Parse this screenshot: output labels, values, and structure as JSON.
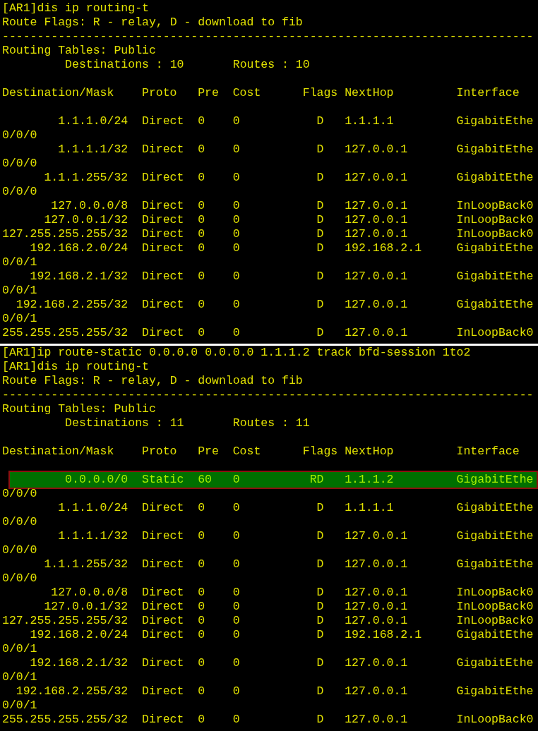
{
  "panels": [
    {
      "commands": [
        "[AR1]dis ip routing-t"
      ],
      "flags_legend": "Route Flags: R - relay, D - download to fib",
      "rule": "----------------------------------------------------------------------------",
      "table_title": "Routing Tables: Public",
      "summary": [
        "Destinations : 10",
        "Routes : 10"
      ],
      "columns": [
        "Destination/Mask",
        "Proto",
        "Pre",
        "Cost",
        "Flags",
        "NextHop",
        "Interface"
      ],
      "routes": [
        {
          "destination": "1.1.1.0/24",
          "proto": "Direct",
          "pre": "0",
          "cost": "0",
          "flags": "D",
          "nexthop": "1.1.1.1",
          "interface": "GigabitEthe",
          "interface_wrap": "0/0/0",
          "selected": false
        },
        {
          "destination": "1.1.1.1/32",
          "proto": "Direct",
          "pre": "0",
          "cost": "0",
          "flags": "D",
          "nexthop": "127.0.0.1",
          "interface": "GigabitEthe",
          "interface_wrap": "0/0/0",
          "selected": false
        },
        {
          "destination": "1.1.1.255/32",
          "proto": "Direct",
          "pre": "0",
          "cost": "0",
          "flags": "D",
          "nexthop": "127.0.0.1",
          "interface": "GigabitEthe",
          "interface_wrap": "0/0/0",
          "selected": false
        },
        {
          "destination": "127.0.0.0/8",
          "proto": "Direct",
          "pre": "0",
          "cost": "0",
          "flags": "D",
          "nexthop": "127.0.0.1",
          "interface": "InLoopBack0",
          "selected": false
        },
        {
          "destination": "127.0.0.1/32",
          "proto": "Direct",
          "pre": "0",
          "cost": "0",
          "flags": "D",
          "nexthop": "127.0.0.1",
          "interface": "InLoopBack0",
          "selected": false
        },
        {
          "destination": "127.255.255.255/32",
          "proto": "Direct",
          "pre": "0",
          "cost": "0",
          "flags": "D",
          "nexthop": "127.0.0.1",
          "interface": "InLoopBack0",
          "selected": false
        },
        {
          "destination": "192.168.2.0/24",
          "proto": "Direct",
          "pre": "0",
          "cost": "0",
          "flags": "D",
          "nexthop": "192.168.2.1",
          "interface": "GigabitEthe",
          "interface_wrap": "0/0/1",
          "selected": false
        },
        {
          "destination": "192.168.2.1/32",
          "proto": "Direct",
          "pre": "0",
          "cost": "0",
          "flags": "D",
          "nexthop": "127.0.0.1",
          "interface": "GigabitEthe",
          "interface_wrap": "0/0/1",
          "selected": false
        },
        {
          "destination": "192.168.2.255/32",
          "proto": "Direct",
          "pre": "0",
          "cost": "0",
          "flags": "D",
          "nexthop": "127.0.0.1",
          "interface": "GigabitEthe",
          "interface_wrap": "0/0/1",
          "selected": false
        },
        {
          "destination": "255.255.255.255/32",
          "proto": "Direct",
          "pre": "0",
          "cost": "0",
          "flags": "D",
          "nexthop": "127.0.0.1",
          "interface": "InLoopBack0",
          "selected": false
        }
      ]
    },
    {
      "commands": [
        "[AR1]ip route-static 0.0.0.0 0.0.0.0 1.1.1.2 track bfd-session 1to2",
        "[AR1]dis ip routing-t"
      ],
      "flags_legend": "Route Flags: R - relay, D - download to fib",
      "rule": "----------------------------------------------------------------------------",
      "table_title": "Routing Tables: Public",
      "summary": [
        "Destinations : 11",
        "Routes : 11"
      ],
      "columns": [
        "Destination/Mask",
        "Proto",
        "Pre",
        "Cost",
        "Flags",
        "NextHop",
        "Interface"
      ],
      "routes": [
        {
          "destination": "0.0.0.0/0",
          "proto": "Static",
          "pre": "60",
          "cost": "0",
          "flags": "RD",
          "nexthop": "1.1.1.2",
          "interface": "GigabitEthe",
          "interface_wrap": "0/0/0",
          "selected": true
        },
        {
          "destination": "1.1.1.0/24",
          "proto": "Direct",
          "pre": "0",
          "cost": "0",
          "flags": "D",
          "nexthop": "1.1.1.1",
          "interface": "GigabitEthe",
          "interface_wrap": "0/0/0",
          "selected": false
        },
        {
          "destination": "1.1.1.1/32",
          "proto": "Direct",
          "pre": "0",
          "cost": "0",
          "flags": "D",
          "nexthop": "127.0.0.1",
          "interface": "GigabitEthe",
          "interface_wrap": "0/0/0",
          "selected": false
        },
        {
          "destination": "1.1.1.255/32",
          "proto": "Direct",
          "pre": "0",
          "cost": "0",
          "flags": "D",
          "nexthop": "127.0.0.1",
          "interface": "GigabitEthe",
          "interface_wrap": "0/0/0",
          "selected": false
        },
        {
          "destination": "127.0.0.0/8",
          "proto": "Direct",
          "pre": "0",
          "cost": "0",
          "flags": "D",
          "nexthop": "127.0.0.1",
          "interface": "InLoopBack0",
          "selected": false
        },
        {
          "destination": "127.0.0.1/32",
          "proto": "Direct",
          "pre": "0",
          "cost": "0",
          "flags": "D",
          "nexthop": "127.0.0.1",
          "interface": "InLoopBack0",
          "selected": false
        },
        {
          "destination": "127.255.255.255/32",
          "proto": "Direct",
          "pre": "0",
          "cost": "0",
          "flags": "D",
          "nexthop": "127.0.0.1",
          "interface": "InLoopBack0",
          "selected": false
        },
        {
          "destination": "192.168.2.0/24",
          "proto": "Direct",
          "pre": "0",
          "cost": "0",
          "flags": "D",
          "nexthop": "192.168.2.1",
          "interface": "GigabitEthe",
          "interface_wrap": "0/0/1",
          "selected": false
        },
        {
          "destination": "192.168.2.1/32",
          "proto": "Direct",
          "pre": "0",
          "cost": "0",
          "flags": "D",
          "nexthop": "127.0.0.1",
          "interface": "GigabitEthe",
          "interface_wrap": "0/0/1",
          "selected": false
        },
        {
          "destination": "192.168.2.255/32",
          "proto": "Direct",
          "pre": "0",
          "cost": "0",
          "flags": "D",
          "nexthop": "127.0.0.1",
          "interface": "GigabitEthe",
          "interface_wrap": "0/0/1",
          "selected": false
        },
        {
          "destination": "255.255.255.255/32",
          "proto": "Direct",
          "pre": "0",
          "cost": "0",
          "flags": "D",
          "nexthop": "127.0.0.1",
          "interface": "InLoopBack0",
          "selected": false
        }
      ]
    }
  ]
}
